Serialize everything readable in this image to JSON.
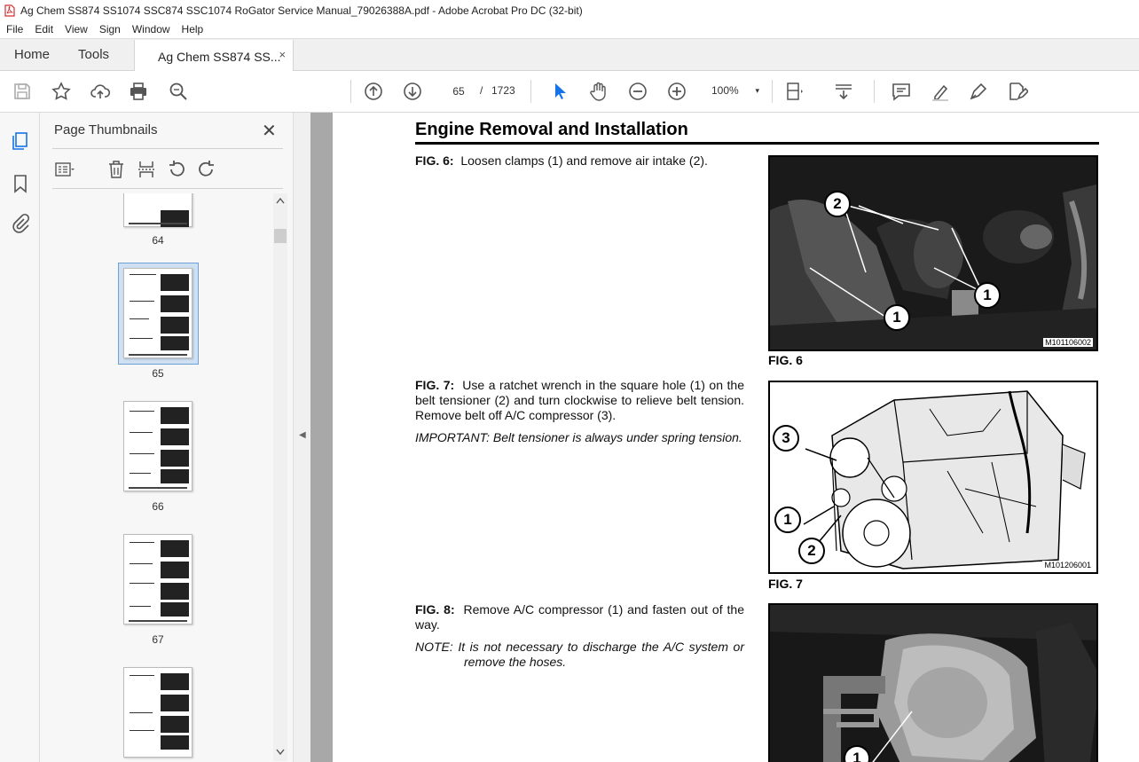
{
  "window": {
    "title": "Ag Chem SS874 SS1074 SSC874 SSC1074 RoGator Service Manual_79026388A.pdf - Adobe Acrobat Pro DC (32-bit)"
  },
  "menu": [
    "File",
    "Edit",
    "View",
    "Sign",
    "Window",
    "Help"
  ],
  "tabs": {
    "home": "Home",
    "tools": "Tools",
    "document": "Ag Chem SS874 SS...",
    "close": "×"
  },
  "toolbar": {
    "page_current": "65",
    "page_sep": "/",
    "page_total": "1723",
    "zoom": "100%",
    "zoom_caret": "▾"
  },
  "panel": {
    "title": "Page Thumbnails",
    "close": "✕",
    "thumbs": [
      {
        "label": "64"
      },
      {
        "label": "65"
      },
      {
        "label": "66"
      },
      {
        "label": "67"
      }
    ]
  },
  "document": {
    "title": "Engine Removal and Installation",
    "fig6": {
      "lead": "FIG. 6:",
      "text": "Loosen clamps (1) and remove air intake (2).",
      "caption": "FIG. 6",
      "code": "M101106002",
      "callouts": [
        "2",
        "1",
        "1"
      ]
    },
    "fig7": {
      "lead": "FIG. 7:",
      "text": "Use a ratchet wrench in the square hole (1) on the belt tensioner (2) and turn clockwise to relieve belt tension. Remove belt off A/C compressor (3).",
      "note_lead": "IMPORTANT:",
      "note": "Belt tensioner is always under spring tension.",
      "caption": "FIG. 7",
      "code": "M101206001",
      "callouts": [
        "3",
        "1",
        "2"
      ]
    },
    "fig8": {
      "lead": "FIG. 8:",
      "text": "Remove A/C compressor (1) and fasten out of the way.",
      "note_lead": "NOTE:",
      "note": "It is not necessary to discharge the A/C system or remove the hoses.",
      "callouts": [
        "1"
      ]
    }
  },
  "colors": {
    "accent_blue": "#1473e6",
    "selected_thumb": "#cfe0f3"
  }
}
